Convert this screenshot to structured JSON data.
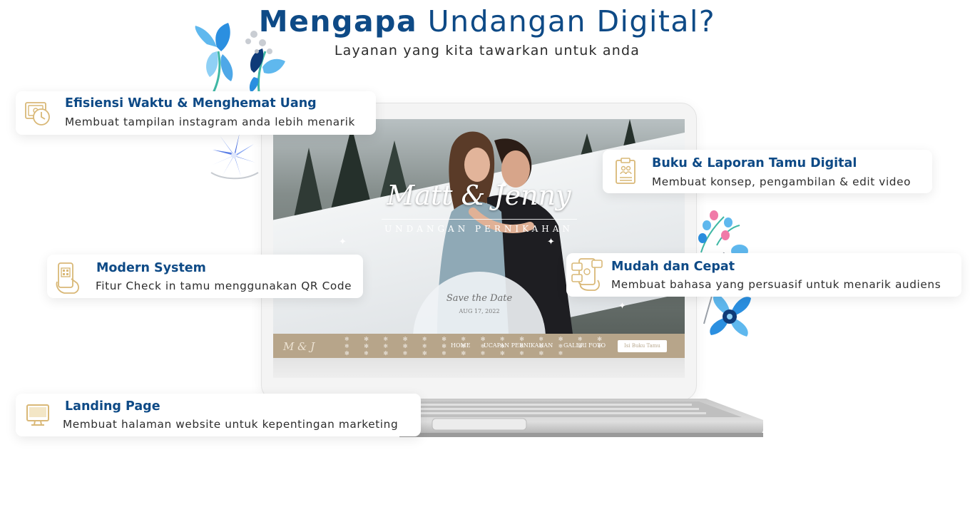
{
  "header": {
    "title_bold": "Mengapa",
    "title_rest": " Undangan Digital?",
    "subtitle": "Layanan yang kita tawarkan untuk anda"
  },
  "colors": {
    "heading_blue": "#0e4a86",
    "icon_gold": "#d9b877",
    "flower_blue": "#2b8fe0",
    "flower_navy": "#0e3a78",
    "nav_strip": "#b7a58a"
  },
  "features": [
    {
      "icon": "clock-money-icon",
      "title": "Efisiensi Waktu & Menghemat Uang",
      "desc": "Membuat tampilan instagram anda lebih menarik"
    },
    {
      "icon": "guest-book-icon",
      "title": "Buku & Laporan Tamu Digital",
      "desc": "Membuat konsep, pengambilan & edit video"
    },
    {
      "icon": "qr-phone-icon",
      "title": "Modern System",
      "desc": "Fitur Check in tamu menggunakan QR Code"
    },
    {
      "icon": "social-phone-icon",
      "title": "Mudah dan Cepat",
      "desc": "Membuat bahasa yang persuasif untuk menarik audiens"
    },
    {
      "icon": "monitor-icon",
      "title": "Landing Page",
      "desc": "Membuat halaman website untuk kepentingan marketing"
    }
  ],
  "laptop_screen": {
    "names": "Matt & Jenny",
    "invitation": "UNDANGAN PERNIKAHAN",
    "save_the_date": "Save the Date",
    "date": "AUG 17, 2022",
    "monogram": "M & J",
    "nav": [
      "HOME",
      "UCAPAN PERNIKAHAN",
      "GALERI FOTO"
    ],
    "nav_button": "Isi Buku Tamu"
  }
}
